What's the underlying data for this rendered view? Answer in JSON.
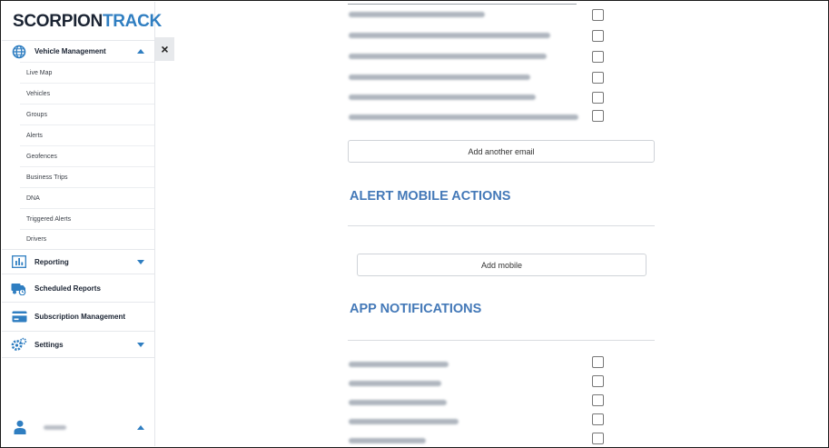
{
  "brand": {
    "part1": "SCORPION",
    "part2": "TRACK"
  },
  "sidebar": {
    "vehicle_management": {
      "label": "Vehicle Management",
      "items": [
        "Live Map",
        "Vehicles",
        "Groups",
        "Alerts",
        "Geofences",
        "Business Trips",
        "DNA",
        "Triggered Alerts",
        "Drivers"
      ]
    },
    "reporting": "Reporting",
    "scheduled_reports": "Scheduled Reports",
    "subscription_management": "Subscription Management",
    "settings": "Settings",
    "close": "×"
  },
  "main": {
    "add_email_label": "Add another email",
    "alert_mobile_title": "ALERT MOBILE ACTIONS",
    "add_mobile_label": "Add mobile",
    "app_notifications_title": "APP NOTIFICATIONS"
  },
  "colors": {
    "accent": "#2f7ec1",
    "heading": "#4479b8",
    "logo_dark": "#1b2433"
  }
}
